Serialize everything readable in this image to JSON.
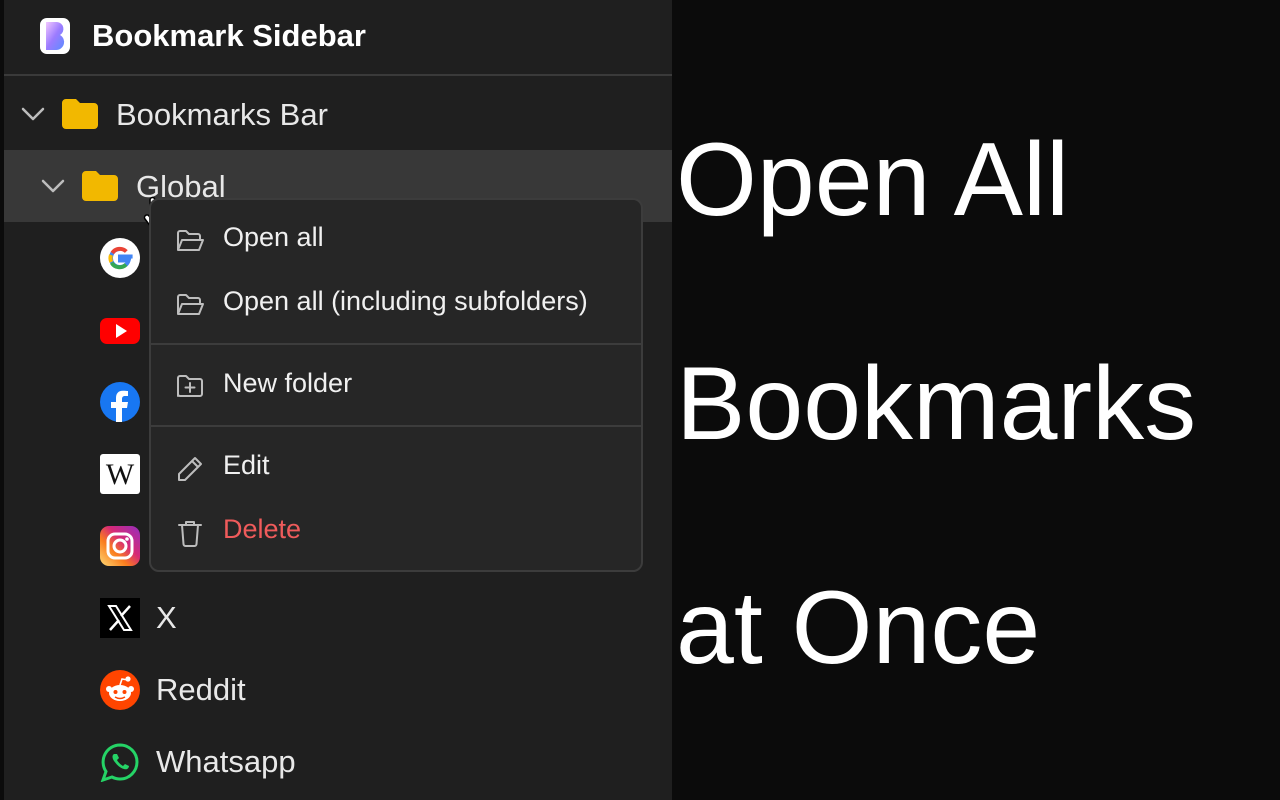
{
  "header": {
    "title": "Bookmark Sidebar",
    "logo_icon": "bookmark-sidebar-logo"
  },
  "tree": {
    "root": {
      "label": "Bookmarks Bar",
      "icon": "folder-icon",
      "expanded": true
    },
    "folder": {
      "label": "Global",
      "icon": "folder-icon",
      "expanded": true
    },
    "bookmarks": [
      {
        "label": "",
        "icon": "google-icon"
      },
      {
        "label": "",
        "icon": "youtube-icon"
      },
      {
        "label": "",
        "icon": "facebook-icon"
      },
      {
        "label": "",
        "icon": "wikipedia-icon"
      },
      {
        "label": "",
        "icon": "instagram-icon"
      },
      {
        "label": "X",
        "icon": "x-icon"
      },
      {
        "label": "Reddit",
        "icon": "reddit-icon"
      },
      {
        "label": "Whatsapp",
        "icon": "whatsapp-icon"
      }
    ]
  },
  "context_menu": {
    "open_all": "Open all",
    "open_all_sub": "Open all (including subfolders)",
    "new_folder": "New folder",
    "edit": "Edit",
    "delete": "Delete"
  },
  "hero": {
    "line1": "Open All",
    "line2": "Bookmarks",
    "line3": "at Once"
  },
  "colors": {
    "folder": "#f2b800",
    "delete": "#ef5b5b",
    "sidebar_bg": "#1f1f1f",
    "page_bg": "#0b0b0b",
    "selected_row": "#383838"
  }
}
